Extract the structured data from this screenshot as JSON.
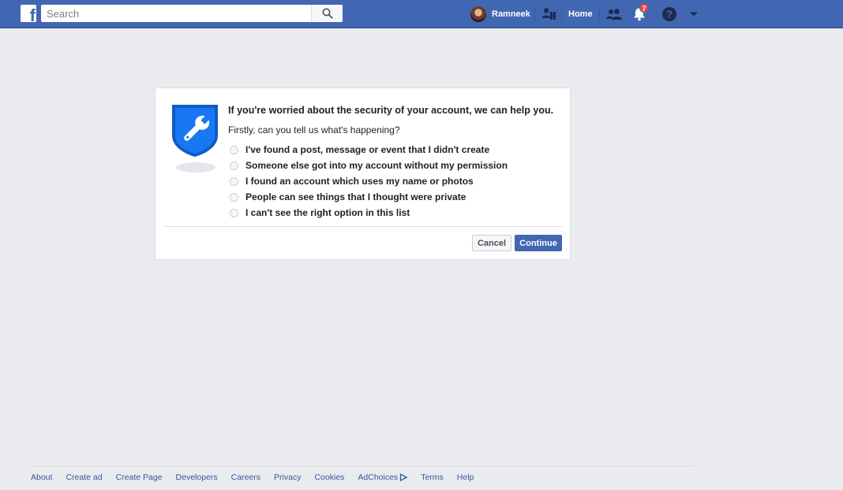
{
  "topbar": {
    "logo_letter": "f",
    "search_placeholder": "Search",
    "profile_name": "Ramneek",
    "home_label": "Home",
    "notification_count": "7",
    "icons": [
      "friends-requests-icon",
      "messenger-people-icon",
      "notifications-bell-icon",
      "help-question-icon",
      "account-dropdown-icon",
      "search-icon"
    ],
    "brand_color": "#4267b2"
  },
  "dialog": {
    "title": "If you're worried about the security of your account, we can help you.",
    "subtitle": "Firstly, can you tell us what's happening?",
    "options": [
      "I've found a post, message or event that I didn't create",
      "Someone else got into my account without my permission",
      "I found an account which uses my name or photos",
      "People can see things that I thought were private",
      "I can't see the right option in this list"
    ],
    "cancel_label": "Cancel",
    "continue_label": "Continue",
    "shield_color": "#1877f2"
  },
  "footer": {
    "links": [
      "About",
      "Create ad",
      "Create Page",
      "Developers",
      "Careers",
      "Privacy",
      "Cookies",
      "AdChoices",
      "Terms",
      "Help"
    ]
  }
}
